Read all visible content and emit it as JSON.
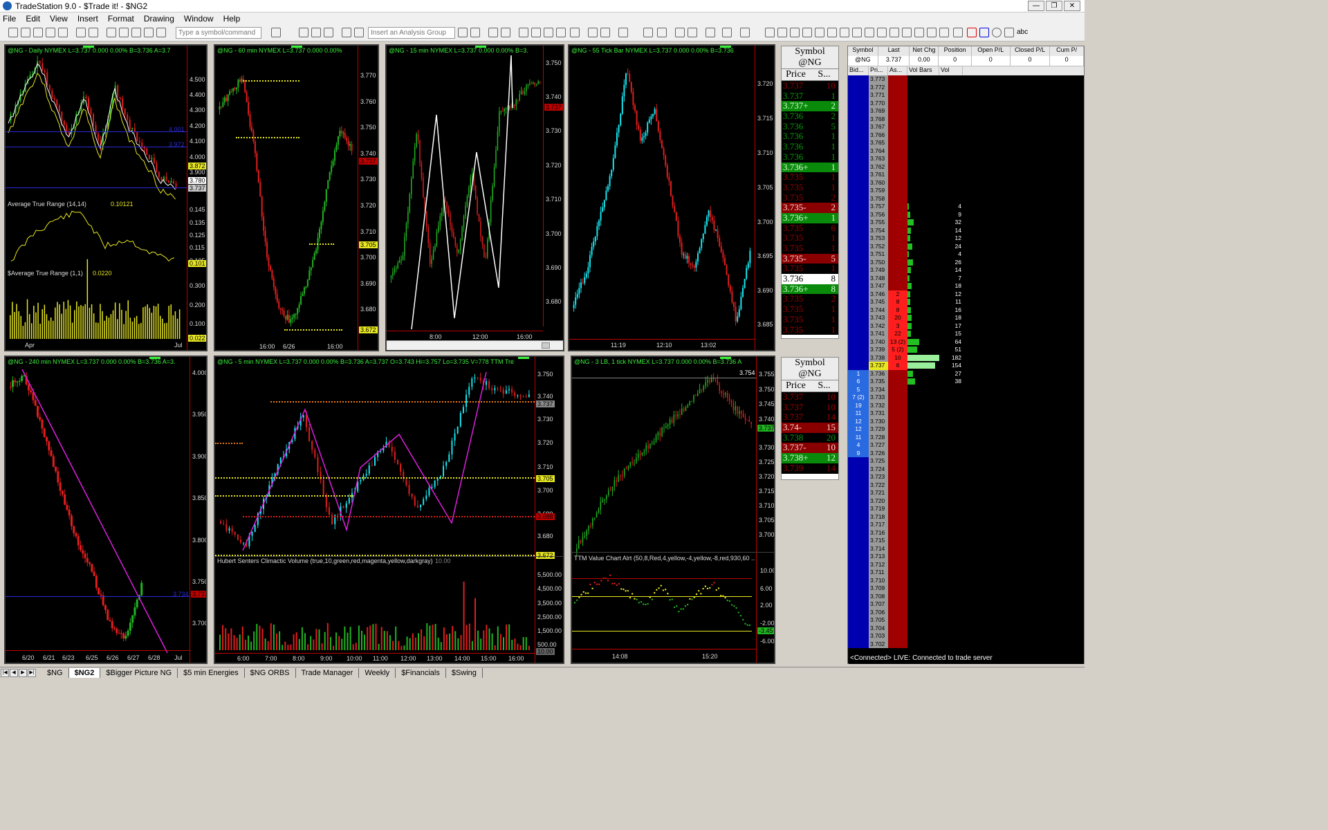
{
  "app": {
    "title": "TradeStation 9.0 - $Trade it! - $NG2",
    "window_buttons": [
      "—",
      "❐",
      "✕"
    ]
  },
  "menu": [
    "File",
    "Edit",
    "View",
    "Insert",
    "Format",
    "Drawing",
    "Window",
    "Help"
  ],
  "toolbar": {
    "symbol_placeholder": "Type a symbol/command",
    "analysis_placeholder": "Insert an Analysis Group",
    "text_tool": "abc"
  },
  "colors": {
    "up_bar": "#22b422",
    "down_bar": "#e01e1e",
    "cyan_bar": "#19e6f0",
    "magenta": "#e01ee0",
    "yellow": "#e8e822",
    "blue_line": "#2a2adc",
    "axis_red": "#c00000",
    "header_green": "#3cf03c"
  },
  "charts": {
    "daily": {
      "header": "@NG - Daily  NYMEX  L=3.737  0.000   0.00%      B=3.736  A=3.7",
      "prices": [
        "4.500",
        "4.400",
        "4.300",
        "4.200",
        "4.100",
        "4.000",
        "3.900"
      ],
      "tags": {
        "y1": "3.872",
        "w1": "3.780",
        "w2": "3.737",
        "b1": "4.001",
        "b2": "3.972"
      },
      "atr14_label": "Average True Range (14,14)",
      "atr14_value": "0.10121",
      "atr14_ticks": [
        "0.145",
        "0.135",
        "0.125",
        "0.115",
        "0.105"
      ],
      "atr14_tag": "0.101",
      "atr1_label": "$Average True Range (1,1)",
      "atr1_value": "0.0220",
      "atr1_ticks": [
        "0.300",
        "0.200",
        "0.100"
      ],
      "atr1_tag": "0.022",
      "xlabels": [
        "Apr",
        "Jul"
      ]
    },
    "m60": {
      "header": "@NG - 60 min  NYMEX  L=3.737  0.000   0.00%",
      "prices": [
        "3.770",
        "3.760",
        "3.750",
        "3.740",
        "3.730",
        "3.720",
        "3.710",
        "3.700",
        "3.690",
        "3.680"
      ],
      "tags": {
        "r1": "3.737",
        "y1": "3.705",
        "y2": "3.672"
      },
      "xlabels": [
        "16:00",
        "6/26",
        "16:00"
      ]
    },
    "m15": {
      "header": "@NG - 15 min  NYMEX  L=3.737  0.000   0.00%      B=3.",
      "prices": [
        "3.750",
        "3.740",
        "3.730",
        "3.720",
        "3.710",
        "3.700",
        "3.690",
        "3.680"
      ],
      "tags": {
        "r1": "3.737"
      },
      "xlabels": [
        "8:00",
        "12:00",
        "16:00"
      ]
    },
    "tick55": {
      "header": "@NG - 55 Tick Bar  NYMEX  L=3.737  0.000   0.00%      B=3.736",
      "prices": [
        "3.720",
        "3.715",
        "3.710",
        "3.705",
        "3.700",
        "3.695",
        "3.690",
        "3.685"
      ],
      "xlabels": [
        "11:19",
        "12:10",
        "13:02"
      ]
    },
    "m240": {
      "header": "@NG - 240 min  NYMEX  L=3.737  0.000   0.00%      B=3.736  A=3.",
      "prices": [
        "4.000",
        "3.950",
        "3.900",
        "3.850",
        "3.800",
        "3.750",
        "3.700"
      ],
      "tags": {
        "r1": "3.737",
        "b1": "3.734"
      },
      "xlabels": [
        "6/20",
        "6/21",
        "6/23",
        "6/25",
        "6/26",
        "6/27",
        "6/28",
        "Jul"
      ]
    },
    "m5": {
      "header": "@NG - 5 min  NYMEX  L=3.737  0.000   0.00%      B=3.736  A=3.737  O=3.743  Hi=3.757  Lo=3.735  V=778  TTM Tre",
      "prices": [
        "3.750",
        "3.740",
        "3.730",
        "3.720",
        "3.710",
        "3.700",
        "3.690",
        "3.680"
      ],
      "tags": {
        "g1": "3.737",
        "y1": "3.705",
        "r1": "3.688",
        "y2": "3.672"
      },
      "vol_label": "Hubert Senters Climactic Volume (true,10,green,red,magenta,yellow,darkgray)",
      "vol_value": "10.00",
      "vol_ticks": [
        "5,500.00",
        "4,500.00",
        "3,500.00",
        "2,500.00",
        "1,500.00",
        "500.00"
      ],
      "vol_tag": "10.00",
      "xlabels": [
        "6:00",
        "7:00",
        "8:00",
        "9:00",
        "10:00",
        "11:00",
        "12:00",
        "13:00",
        "14:00",
        "15:00",
        "16:00"
      ]
    },
    "lb3": {
      "header": "@NG - 3 LB, 1 tick  NYMEX  L=3.737  0.000   0.00%      B=3.736  A",
      "prices": [
        "3.755",
        "3.750",
        "3.745",
        "3.740",
        "3.735",
        "3.730",
        "3.725",
        "3.720",
        "3.715",
        "3.710",
        "3.705",
        "3.700"
      ],
      "tags": {
        "h1": "3.754",
        "g1": "3.737"
      },
      "ttm_label": "TTM Value Chart Alrt (50,8,Red,4,yellow,-4,yellow,-8,red,930,60 ...",
      "ttm_ticks": [
        "10.00",
        "6.00",
        "2.00",
        "-2.00",
        "-6.00"
      ],
      "ttm_tag": "-3.45",
      "xlabels": [
        "14:08",
        "15:20"
      ]
    }
  },
  "ladders": [
    {
      "symbol_label": "Symbol",
      "symbol": "@NG",
      "price_label": "Price",
      "size_label": "S...",
      "rows": [
        {
          "p": "3.737",
          "s": "10",
          "bg": "#000",
          "fg": "#a00000"
        },
        {
          "p": "3.737",
          "s": "1",
          "bg": "#000",
          "fg": "#0a9a0a"
        },
        {
          "p": "3.737+",
          "s": "2",
          "bg": "#0a8a0a",
          "fg": "#d8ffd8"
        },
        {
          "p": "3.736",
          "s": "2",
          "bg": "#000",
          "fg": "#0a9a0a"
        },
        {
          "p": "3.736",
          "s": "5",
          "bg": "#000",
          "fg": "#0a9a0a"
        },
        {
          "p": "3.736",
          "s": "1",
          "bg": "#000",
          "fg": "#0a9a0a"
        },
        {
          "p": "3.736",
          "s": "1",
          "bg": "#000",
          "fg": "#0a9a0a"
        },
        {
          "p": "3.736",
          "s": "1",
          "bg": "#000",
          "fg": "#0a9a0a"
        },
        {
          "p": "3.736+",
          "s": "1",
          "bg": "#0a8a0a",
          "fg": "#d8ffd8"
        },
        {
          "p": "3.735",
          "s": "1",
          "bg": "#000",
          "fg": "#a00000"
        },
        {
          "p": "3.735",
          "s": "1",
          "bg": "#000",
          "fg": "#a00000"
        },
        {
          "p": "3.735",
          "s": "2",
          "bg": "#000",
          "fg": "#a00000"
        },
        {
          "p": "3.735-",
          "s": "2",
          "bg": "#8a0000",
          "fg": "#ffd8d8"
        },
        {
          "p": "3.736+",
          "s": "1",
          "bg": "#0a8a0a",
          "fg": "#d8ffd8"
        },
        {
          "p": "3.735",
          "s": "6",
          "bg": "#000",
          "fg": "#a00000"
        },
        {
          "p": "3.735",
          "s": "1",
          "bg": "#000",
          "fg": "#a00000"
        },
        {
          "p": "3.735",
          "s": "1",
          "bg": "#000",
          "fg": "#a00000"
        },
        {
          "p": "3.735-",
          "s": "5",
          "bg": "#8a0000",
          "fg": "#ffd8d8"
        },
        {
          "p": "3.735",
          "s": "1",
          "bg": "#000",
          "fg": "#a00000"
        },
        {
          "p": "3.736",
          "s": "8",
          "bg": "#ffffff",
          "fg": "#000000"
        },
        {
          "p": "3.736+",
          "s": "8",
          "bg": "#0a8a0a",
          "fg": "#d8ffd8"
        },
        {
          "p": "3.735",
          "s": "2",
          "bg": "#000",
          "fg": "#a00000"
        },
        {
          "p": "3.735",
          "s": "1",
          "bg": "#000",
          "fg": "#a00000"
        },
        {
          "p": "3.735",
          "s": "1",
          "bg": "#000",
          "fg": "#a00000"
        },
        {
          "p": "3.735",
          "s": "1",
          "bg": "#000",
          "fg": "#a00000"
        }
      ]
    },
    {
      "symbol_label": "Symbol",
      "symbol": "@NG",
      "price_label": "Price",
      "size_label": "S...",
      "rows": [
        {
          "p": "3.737",
          "s": "10",
          "bg": "#000",
          "fg": "#a00000"
        },
        {
          "p": "3.737",
          "s": "10",
          "bg": "#000",
          "fg": "#a00000"
        },
        {
          "p": "3.737",
          "s": "14",
          "bg": "#000",
          "fg": "#a00000"
        },
        {
          "p": "3.74-",
          "s": "15",
          "bg": "#8a0000",
          "fg": "#ffd8d8"
        },
        {
          "p": "3.738",
          "s": "20",
          "bg": "#000",
          "fg": "#0a9a0a"
        },
        {
          "p": "3.737-",
          "s": "10",
          "bg": "#8a0000",
          "fg": "#ffd8d8"
        },
        {
          "p": "3.738+",
          "s": "12",
          "bg": "#0a8a0a",
          "fg": "#d8ffd8"
        },
        {
          "p": "3.739",
          "s": "14",
          "bg": "#000",
          "fg": "#a00000"
        }
      ]
    }
  ],
  "dom": {
    "quote_headers": [
      "Symbol",
      "Last",
      "Net Chg",
      "Position",
      "Open P/L",
      "Closed P/L",
      "Cum P/"
    ],
    "quote_row": [
      "@NG",
      "3.737",
      "0.00",
      "0",
      "0",
      "0",
      "0"
    ],
    "grid_headers": [
      "Bid...",
      "Pri...",
      "As...",
      "Vol Bars",
      "Vol"
    ],
    "rows": [
      {
        "price": "3.773",
        "bid": "",
        "ask": "",
        "vol": "",
        "bar": 0
      },
      {
        "price": "3.772",
        "bid": "",
        "ask": "",
        "vol": "",
        "bar": 0
      },
      {
        "price": "3.771",
        "bid": "",
        "ask": "",
        "vol": "",
        "bar": 0
      },
      {
        "price": "3.770",
        "bid": "",
        "ask": "",
        "vol": "",
        "bar": 0
      },
      {
        "price": "3.769",
        "bid": "",
        "ask": "",
        "vol": "",
        "bar": 0
      },
      {
        "price": "3.768",
        "bid": "",
        "ask": "",
        "vol": "",
        "bar": 0
      },
      {
        "price": "3.767",
        "bid": "",
        "ask": "",
        "vol": "",
        "bar": 0
      },
      {
        "price": "3.766",
        "bid": "",
        "ask": "",
        "vol": "",
        "bar": 0
      },
      {
        "price": "3.765",
        "bid": "",
        "ask": "",
        "vol": "",
        "bar": 0
      },
      {
        "price": "3.764",
        "bid": "",
        "ask": "",
        "vol": "",
        "bar": 0
      },
      {
        "price": "3.763",
        "bid": "",
        "ask": "",
        "vol": "",
        "bar": 0
      },
      {
        "price": "3.762",
        "bid": "",
        "ask": "",
        "vol": "",
        "bar": 0
      },
      {
        "price": "3.761",
        "bid": "",
        "ask": "",
        "vol": "",
        "bar": 0
      },
      {
        "price": "3.760",
        "bid": "",
        "ask": "",
        "vol": "",
        "bar": 0
      },
      {
        "price": "3.759",
        "bid": "",
        "ask": "",
        "vol": "",
        "bar": 0
      },
      {
        "price": "3.758",
        "bid": "",
        "ask": "",
        "vol": "",
        "bar": 0
      },
      {
        "price": "3.757",
        "bid": "",
        "ask": "",
        "vol": "4",
        "bar": 2
      },
      {
        "price": "3.756",
        "bid": "",
        "ask": "",
        "vol": "9",
        "bar": 4
      },
      {
        "price": "3.755",
        "bid": "",
        "ask": "",
        "vol": "32",
        "bar": 9
      },
      {
        "price": "3.754",
        "bid": "",
        "ask": "",
        "vol": "14",
        "bar": 5
      },
      {
        "price": "3.753",
        "bid": "",
        "ask": "",
        "vol": "12",
        "bar": 4
      },
      {
        "price": "3.752",
        "bid": "",
        "ask": "",
        "vol": "24",
        "bar": 7
      },
      {
        "price": "3.751",
        "bid": "",
        "ask": "",
        "vol": "4",
        "bar": 2
      },
      {
        "price": "3.750",
        "bid": "",
        "ask": "",
        "vol": "26",
        "bar": 8
      },
      {
        "price": "3.749",
        "bid": "",
        "ask": "",
        "vol": "14",
        "bar": 5
      },
      {
        "price": "3.748",
        "bid": "",
        "ask": "",
        "vol": "7",
        "bar": 3
      },
      {
        "price": "3.747",
        "bid": "",
        "ask": "",
        "vol": "18",
        "bar": 6
      },
      {
        "price": "3.746",
        "bid": "",
        "ask": "2",
        "vol": "12",
        "bar": 4
      },
      {
        "price": "3.745",
        "bid": "",
        "ask": "8",
        "vol": "11",
        "bar": 4
      },
      {
        "price": "3.744",
        "bid": "",
        "ask": "8",
        "vol": "16",
        "bar": 5
      },
      {
        "price": "3.743",
        "bid": "",
        "ask": "20",
        "vol": "18",
        "bar": 6
      },
      {
        "price": "3.742",
        "bid": "",
        "ask": "3",
        "vol": "17",
        "bar": 6
      },
      {
        "price": "3.741",
        "bid": "",
        "ask": "22",
        "vol": "15",
        "bar": 5
      },
      {
        "price": "3.740",
        "bid": "",
        "ask": "13 (2)",
        "vol": "64",
        "bar": 17
      },
      {
        "price": "3.739",
        "bid": "",
        "ask": "5 (2)",
        "vol": "51",
        "bar": 14
      },
      {
        "price": "3.738",
        "bid": "",
        "ask": "10",
        "vol": "182",
        "bar": 46
      },
      {
        "price": "3.737",
        "bid": "",
        "ask": "6",
        "vol": "154",
        "bar": 40
      },
      {
        "price": "3.736",
        "bid": "1",
        "ask": "",
        "vol": "27",
        "bar": 8
      },
      {
        "price": "3.735",
        "bid": "6",
        "ask": "",
        "vol": "38",
        "bar": 11
      },
      {
        "price": "3.734",
        "bid": "5",
        "ask": "",
        "vol": "",
        "bar": 0
      },
      {
        "price": "3.733",
        "bid": "7 (2)",
        "ask": "",
        "vol": "",
        "bar": 0
      },
      {
        "price": "3.732",
        "bid": "19",
        "ask": "",
        "vol": "",
        "bar": 0
      },
      {
        "price": "3.731",
        "bid": "11",
        "ask": "",
        "vol": "",
        "bar": 0
      },
      {
        "price": "3.730",
        "bid": "12",
        "ask": "",
        "vol": "",
        "bar": 0
      },
      {
        "price": "3.729",
        "bid": "12",
        "ask": "",
        "vol": "",
        "bar": 0
      },
      {
        "price": "3.728",
        "bid": "11",
        "ask": "",
        "vol": "",
        "bar": 0
      },
      {
        "price": "3.727",
        "bid": "4",
        "ask": "",
        "vol": "",
        "bar": 0
      },
      {
        "price": "3.726",
        "bid": "9",
        "ask": "",
        "vol": "",
        "bar": 0
      },
      {
        "price": "3.725",
        "bid": "",
        "ask": "",
        "vol": "",
        "bar": 0
      },
      {
        "price": "3.724",
        "bid": "",
        "ask": "",
        "vol": "",
        "bar": 0
      },
      {
        "price": "3.723",
        "bid": "",
        "ask": "",
        "vol": "",
        "bar": 0
      },
      {
        "price": "3.722",
        "bid": "",
        "ask": "",
        "vol": "",
        "bar": 0
      },
      {
        "price": "3.721",
        "bid": "",
        "ask": "",
        "vol": "",
        "bar": 0
      },
      {
        "price": "3.720",
        "bid": "",
        "ask": "",
        "vol": "",
        "bar": 0
      },
      {
        "price": "3.719",
        "bid": "",
        "ask": "",
        "vol": "",
        "bar": 0
      },
      {
        "price": "3.718",
        "bid": "",
        "ask": "",
        "vol": "",
        "bar": 0
      },
      {
        "price": "3.717",
        "bid": "",
        "ask": "",
        "vol": "",
        "bar": 0
      },
      {
        "price": "3.716",
        "bid": "",
        "ask": "",
        "vol": "",
        "bar": 0
      },
      {
        "price": "3.715",
        "bid": "",
        "ask": "",
        "vol": "",
        "bar": 0
      },
      {
        "price": "3.714",
        "bid": "",
        "ask": "",
        "vol": "",
        "bar": 0
      },
      {
        "price": "3.713",
        "bid": "",
        "ask": "",
        "vol": "",
        "bar": 0
      },
      {
        "price": "3.712",
        "bid": "",
        "ask": "",
        "vol": "",
        "bar": 0
      },
      {
        "price": "3.711",
        "bid": "",
        "ask": "",
        "vol": "",
        "bar": 0
      },
      {
        "price": "3.710",
        "bid": "",
        "ask": "",
        "vol": "",
        "bar": 0
      },
      {
        "price": "3.709",
        "bid": "",
        "ask": "",
        "vol": "",
        "bar": 0
      },
      {
        "price": "3.708",
        "bid": "",
        "ask": "",
        "vol": "",
        "bar": 0
      },
      {
        "price": "3.707",
        "bid": "",
        "ask": "",
        "vol": "",
        "bar": 0
      },
      {
        "price": "3.706",
        "bid": "",
        "ask": "",
        "vol": "",
        "bar": 0
      },
      {
        "price": "3.705",
        "bid": "",
        "ask": "",
        "vol": "",
        "bar": 0
      },
      {
        "price": "3.704",
        "bid": "",
        "ask": "",
        "vol": "",
        "bar": 0
      },
      {
        "price": "3.703",
        "bid": "",
        "ask": "",
        "vol": "",
        "bar": 0
      },
      {
        "price": "3.702",
        "bid": "",
        "ask": "",
        "vol": "",
        "bar": 0
      }
    ],
    "status": "<Connected> LIVE:  Connected to trade server"
  },
  "tabs": [
    "$NG",
    "$NG2",
    "$Bigger Picture NG",
    "$5 min Energies",
    "$NG ORBS",
    "Trade Manager",
    "Weekly",
    "$Financials",
    "$Swing"
  ],
  "tab_nav": [
    "|◀",
    "◀",
    "▶",
    "▶|"
  ]
}
